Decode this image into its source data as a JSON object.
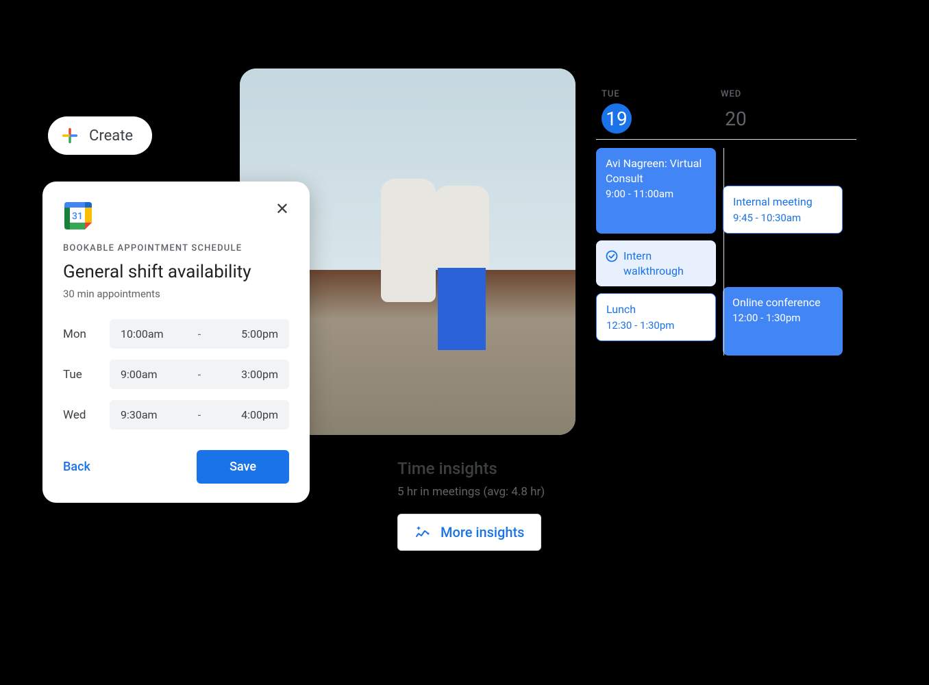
{
  "create_button": {
    "label": "Create"
  },
  "schedule_card": {
    "subtitle": "BOOKABLE APPOINTMENT SCHEDULE",
    "title": "General shift availability",
    "duration": "30 min appointments",
    "logo_day": "31",
    "rows": [
      {
        "day": "Mon",
        "start": "10:00am",
        "end": "5:00pm"
      },
      {
        "day": "Tue",
        "start": "9:00am",
        "end": "3:00pm"
      },
      {
        "day": "Wed",
        "start": "9:30am",
        "end": "4:00pm"
      }
    ],
    "back_label": "Back",
    "save_label": "Save"
  },
  "calendar": {
    "days": [
      {
        "abbr": "TUE",
        "num": "19",
        "active": true
      },
      {
        "abbr": "WED",
        "num": "20",
        "active": false
      }
    ],
    "col_left": [
      {
        "type": "solid",
        "tall": true,
        "title": "Avi Nagreen: Virtual Consult",
        "time": "9:00 - 11:00am"
      },
      {
        "type": "light",
        "title": "Intern walkthrough"
      },
      {
        "type": "hollow",
        "title": "Lunch",
        "time": "12:30 - 1:30pm"
      }
    ],
    "col_right": [
      {
        "type": "hollow",
        "title": "Internal meeting",
        "time": "9:45 - 10:30am"
      },
      {
        "type": "solid",
        "title": "Online conference",
        "time": "12:00 - 1:30pm"
      }
    ]
  },
  "insights": {
    "title": "Time insights",
    "subtitle": "5 hr in meetings (avg: 4.8 hr)",
    "button": "More insights"
  }
}
